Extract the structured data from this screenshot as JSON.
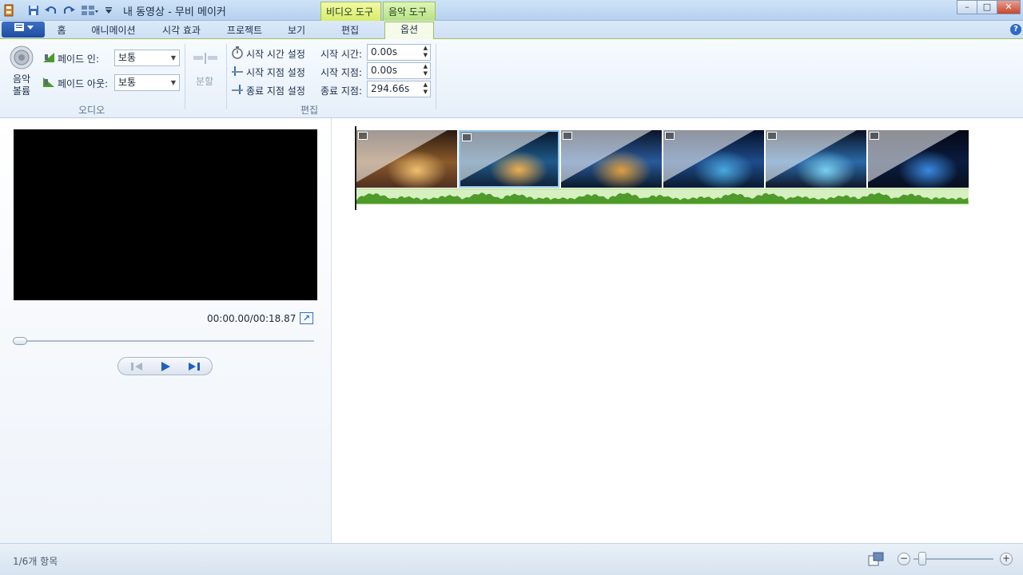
{
  "window": {
    "title": "내 동영상 - 무비 메이커",
    "context_tabs": {
      "video_tools": "비디오 도구",
      "music_tools": "음악 도구"
    },
    "minimize": "–",
    "maximize": "□",
    "close": "✕"
  },
  "tabs": {
    "home": "홈",
    "animations": "애니메이션",
    "visual_effects": "시각 효과",
    "project": "프로젝트",
    "view": "보기",
    "edit": "편집",
    "options": "옵션"
  },
  "ribbon": {
    "music_volume": "음악\n볼륨",
    "fade_in_label": "페이드 인:",
    "fade_in_value": "보통",
    "fade_out_label": "페이드 아웃:",
    "fade_out_value": "보통",
    "audio_group": "오디오",
    "split": "분할",
    "set_start_time": "시작 시간 설정",
    "set_start_point": "시작 지점 설정",
    "set_end_point": "종료 지점 설정",
    "start_time_label": "시작 시간:",
    "start_time_value": "0.00s",
    "start_point_label": "시작 지점:",
    "start_point_value": "0.00s",
    "end_point_label": "종료 지점:",
    "end_point_value": "294.66s",
    "edit_group": "편집"
  },
  "preview": {
    "timecode": "00:00.00/00:18.87",
    "progress": 0
  },
  "clips": [
    {
      "kind": "bokeh",
      "colors": [
        "#2a1a10",
        "#8a5a2a",
        "#f0c070",
        "#503020"
      ]
    },
    {
      "kind": "city-night",
      "colors": [
        "#0a1a30",
        "#1f5a8a",
        "#f0b050",
        "#10233a"
      ]
    },
    {
      "kind": "bridge",
      "colors": [
        "#0a1428",
        "#2a5a9a",
        "#e0a040",
        "#0a1a2a"
      ]
    },
    {
      "kind": "towers",
      "colors": [
        "#061028",
        "#1e4c8c",
        "#4aa8e0",
        "#0a1a30"
      ]
    },
    {
      "kind": "tunnel",
      "colors": [
        "#0a1020",
        "#2a6aa8",
        "#7ad0f0",
        "#10182a"
      ]
    },
    {
      "kind": "fountain",
      "colors": [
        "#050814",
        "#0a1c40",
        "#3a8ae0",
        "#081020"
      ]
    }
  ],
  "audio": {
    "color": "#4e9a2a"
  },
  "status": {
    "items": "1/6개 항목",
    "zoom_level": 0.05
  }
}
